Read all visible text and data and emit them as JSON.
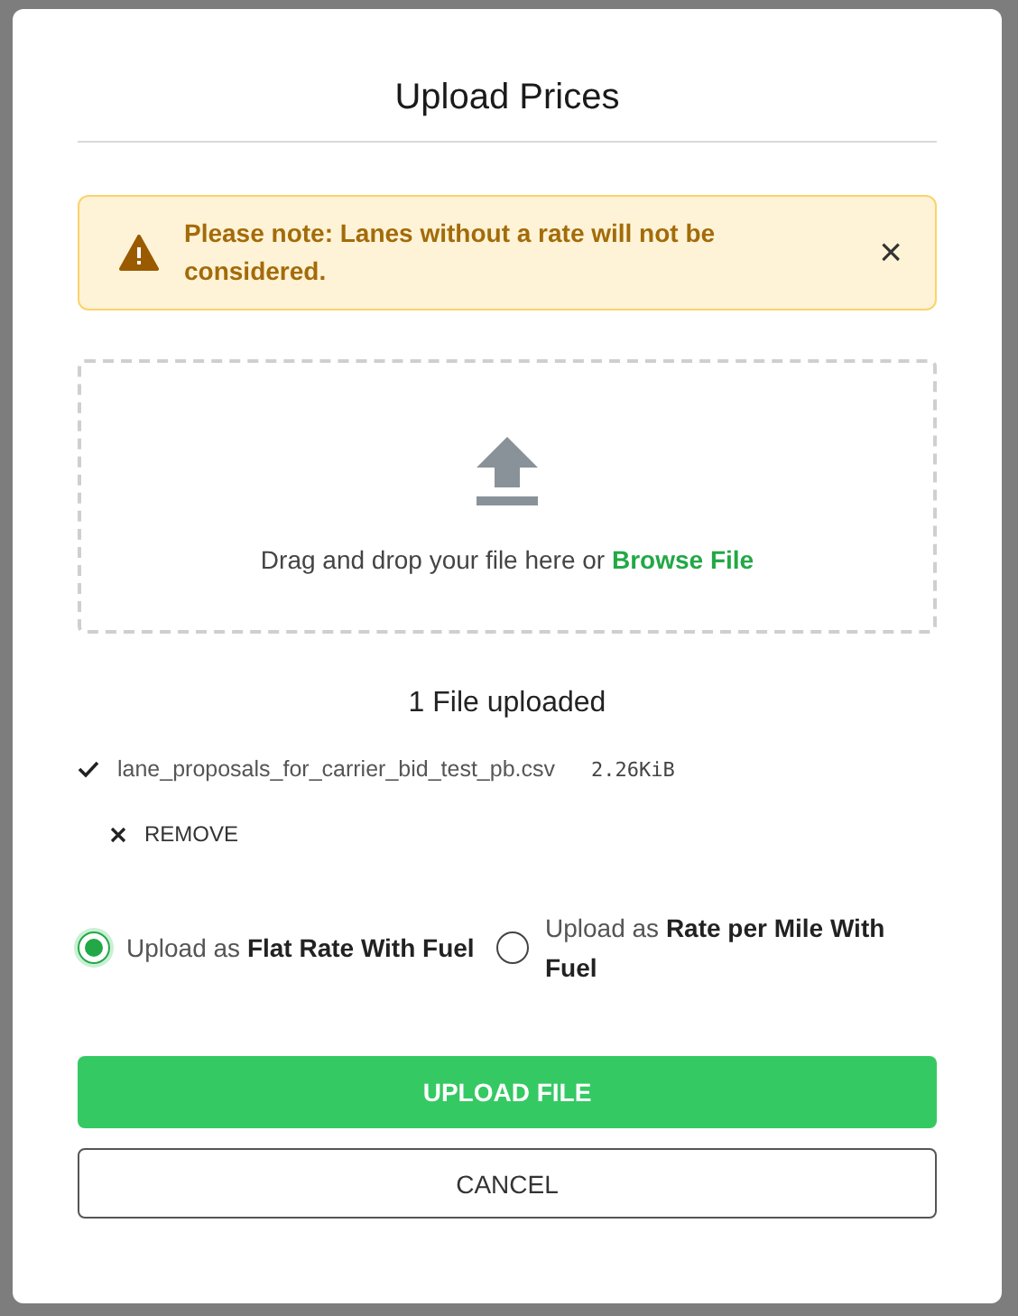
{
  "dialog": {
    "title": "Upload Prices"
  },
  "alert": {
    "message": "Please note: Lanes without a rate will not be considered.",
    "close": "×"
  },
  "dropzone": {
    "text": "Drag and drop your file here or ",
    "link": "Browse File"
  },
  "upload_status": "1 File uploaded",
  "files": [
    {
      "name": "lane_proposals_for_carrier_bid_test_pb.csv",
      "size": "2.26KiB",
      "done": true,
      "remove": "REMOVE"
    }
  ],
  "options": [
    {
      "label": "Upload as **Flat Rate With Fuel**",
      "selected": true
    },
    {
      "label": "Upload as **Rate per Mile With Fuel**",
      "selected": false
    }
  ],
  "buttons": [
    {
      "kind": "primary",
      "label": "UPLOAD FILE"
    },
    {
      "kind": "secondary",
      "label": "CANCEL"
    }
  ]
}
